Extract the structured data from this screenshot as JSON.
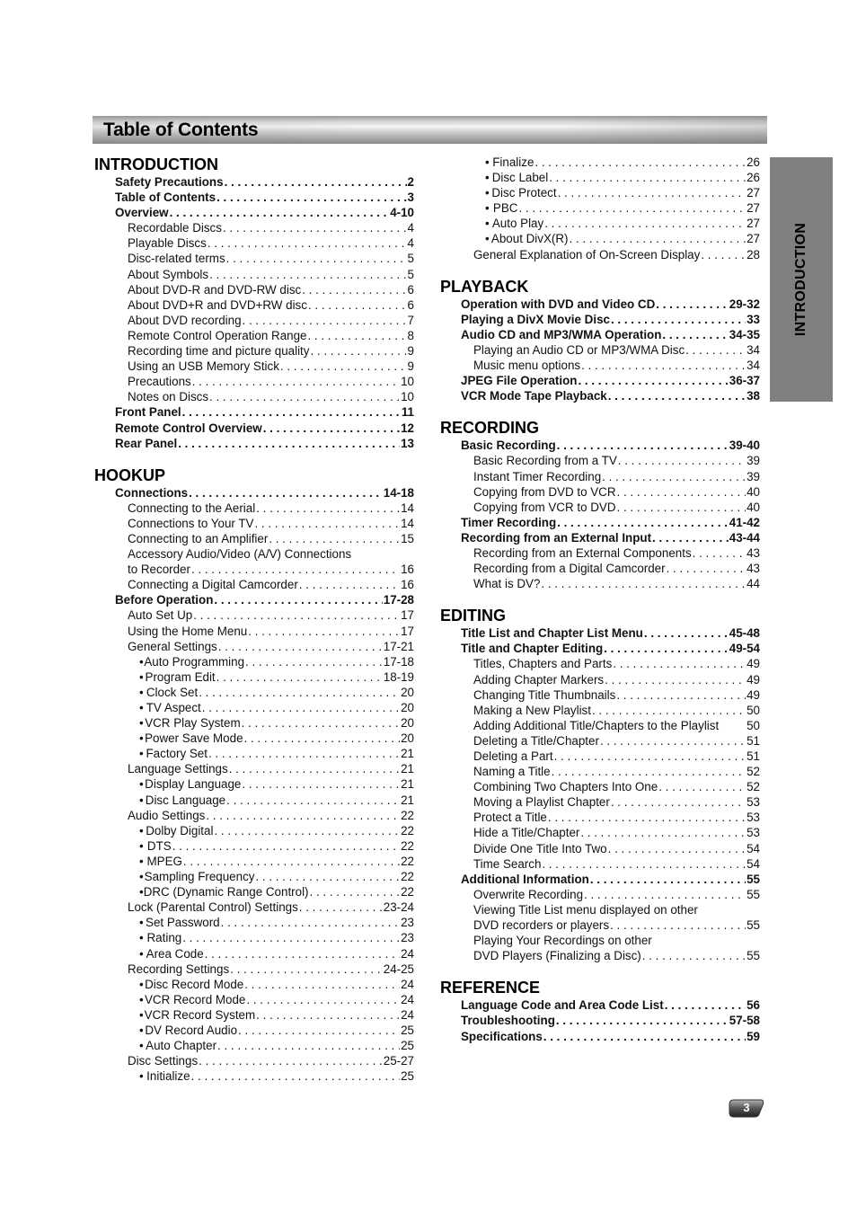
{
  "header": {
    "title": "Table of Contents"
  },
  "side_tab": {
    "label": "INTRODUCTION"
  },
  "page_number": "3",
  "left_column": [
    {
      "heading": "INTRODUCTION",
      "entries": [
        {
          "level": 1,
          "label": "Safety Precautions",
          "page": "2"
        },
        {
          "level": 1,
          "label": "Table of Contents",
          "page": "3"
        },
        {
          "level": 1,
          "label": "Overview",
          "page": "4-10"
        },
        {
          "level": 2,
          "label": "Recordable Discs",
          "page": "4"
        },
        {
          "level": 2,
          "label": "Playable Discs",
          "page": "4"
        },
        {
          "level": 2,
          "label": "Disc-related terms",
          "page": "5"
        },
        {
          "level": 2,
          "label": "About Symbols",
          "page": "5"
        },
        {
          "level": 2,
          "label": "About DVD-R and DVD-RW disc",
          "page": "6"
        },
        {
          "level": 2,
          "label": "About DVD+R and DVD+RW disc",
          "page": "6"
        },
        {
          "level": 2,
          "label": "About DVD recording",
          "page": "7"
        },
        {
          "level": 2,
          "label": "Remote Control Operation Range",
          "page": "8"
        },
        {
          "level": 2,
          "label": "Recording time and picture quality",
          "page": "9"
        },
        {
          "level": 2,
          "label": "Using an USB Memory Stick",
          "page": "9"
        },
        {
          "level": 2,
          "label": "Precautions",
          "page": "10"
        },
        {
          "level": 2,
          "label": "Notes on Discs",
          "page": "10"
        },
        {
          "level": 1,
          "label": "Front Panel",
          "page": "11"
        },
        {
          "level": 1,
          "label": "Remote Control Overview",
          "page": "12"
        },
        {
          "level": 1,
          "label": "Rear Panel",
          "page": "13"
        }
      ]
    },
    {
      "heading": "HOOKUP",
      "entries": [
        {
          "level": 1,
          "label": "Connections",
          "page": "14-18"
        },
        {
          "level": 2,
          "label": "Connecting to the Aerial",
          "page": "14"
        },
        {
          "level": 2,
          "label": "Connections to Your TV",
          "page": "14"
        },
        {
          "level": 2,
          "label": "Connecting to an Amplifier",
          "page": "15"
        },
        {
          "level": 2,
          "label": "Accessory Audio/Video (A/V) Connections",
          "page": ""
        },
        {
          "level": 2,
          "label": "to Recorder",
          "page": "16"
        },
        {
          "level": 2,
          "label": "Connecting a Digital Camcorder",
          "page": "16"
        },
        {
          "level": 1,
          "label": "Before Operation",
          "page": "17-28"
        },
        {
          "level": 2,
          "label": "Auto Set Up",
          "page": "17"
        },
        {
          "level": 2,
          "label": "Using the Home Menu",
          "page": "17"
        },
        {
          "level": 2,
          "label": "General Settings",
          "page": "17-21"
        },
        {
          "level": 3,
          "label": "Auto Programming",
          "page": "17-18"
        },
        {
          "level": 3,
          "label": "Program Edit",
          "page": "18-19"
        },
        {
          "level": 3,
          "label": "Clock Set",
          "page": "20"
        },
        {
          "level": 3,
          "label": "TV Aspect",
          "page": "20"
        },
        {
          "level": 3,
          "label": "VCR Play System",
          "page": "20"
        },
        {
          "level": 3,
          "label": "Power Save Mode",
          "page": "20"
        },
        {
          "level": 3,
          "label": "Factory Set",
          "page": "21"
        },
        {
          "level": 2,
          "label": "Language Settings",
          "page": "21"
        },
        {
          "level": 3,
          "label": "Display Language",
          "page": "21"
        },
        {
          "level": 3,
          "label": "Disc Language",
          "page": "21"
        },
        {
          "level": 2,
          "label": "Audio Settings",
          "page": "22"
        },
        {
          "level": 3,
          "label": "Dolby Digital",
          "page": "22"
        },
        {
          "level": 3,
          "label": "DTS",
          "page": "22"
        },
        {
          "level": 3,
          "label": "MPEG",
          "page": "22"
        },
        {
          "level": 3,
          "label": "Sampling Frequency",
          "page": "22"
        },
        {
          "level": 3,
          "label": "DRC (Dynamic Range Control)",
          "page": "22"
        },
        {
          "level": 2,
          "label": "Lock (Parental Control) Settings",
          "page": "23-24"
        },
        {
          "level": 3,
          "label": "Set Password",
          "page": "23"
        },
        {
          "level": 3,
          "label": "Rating",
          "page": "23"
        },
        {
          "level": 3,
          "label": "Area Code",
          "page": "24"
        },
        {
          "level": 2,
          "label": "Recording Settings",
          "page": "24-25"
        },
        {
          "level": 3,
          "label": "Disc Record Mode",
          "page": "24"
        },
        {
          "level": 3,
          "label": "VCR Record Mode",
          "page": "24"
        },
        {
          "level": 3,
          "label": "VCR Record System",
          "page": "24"
        },
        {
          "level": 3,
          "label": "DV Record Audio",
          "page": "25"
        },
        {
          "level": 3,
          "label": "Auto Chapter",
          "page": "25"
        },
        {
          "level": 2,
          "label": "Disc Settings",
          "page": "25-27"
        },
        {
          "level": 3,
          "label": "Initialize",
          "page": "25"
        }
      ]
    }
  ],
  "right_column": [
    {
      "heading": "",
      "entries": [
        {
          "level": 3,
          "label": "Finalize",
          "page": "26"
        },
        {
          "level": 3,
          "label": "Disc Label",
          "page": "26"
        },
        {
          "level": 3,
          "label": "Disc Protect",
          "page": "27"
        },
        {
          "level": 3,
          "label": "PBC",
          "page": "27"
        },
        {
          "level": 3,
          "label": "Auto Play",
          "page": "27"
        },
        {
          "level": 3,
          "label": "About DivX(R)",
          "page": "27"
        },
        {
          "level": 2,
          "label": "General Explanation of On-Screen Display",
          "page": "28"
        }
      ]
    },
    {
      "heading": "PLAYBACK",
      "entries": [
        {
          "level": 1,
          "label": "Operation with DVD and Video CD",
          "page": "29-32"
        },
        {
          "level": 1,
          "label": "Playing a DivX Movie Disc",
          "page": "33"
        },
        {
          "level": 1,
          "label": "Audio CD and MP3/WMA Operation",
          "page": "34-35"
        },
        {
          "level": 2,
          "label": "Playing an Audio CD or MP3/WMA Disc",
          "page": "34"
        },
        {
          "level": 2,
          "label": "Music menu options",
          "page": "34"
        },
        {
          "level": 1,
          "label": "JPEG File Operation",
          "page": "36-37"
        },
        {
          "level": 1,
          "label": "VCR Mode Tape Playback",
          "page": "38"
        }
      ]
    },
    {
      "heading": "RECORDING",
      "entries": [
        {
          "level": 1,
          "label": "Basic Recording",
          "page": "39-40"
        },
        {
          "level": 2,
          "label": "Basic Recording from a TV",
          "page": "39"
        },
        {
          "level": 2,
          "label": "Instant Timer Recording",
          "page": "39"
        },
        {
          "level": 2,
          "label": "Copying from DVD to VCR",
          "page": "40"
        },
        {
          "level": 2,
          "label": "Copying from VCR to DVD",
          "page": "40"
        },
        {
          "level": 1,
          "label": "Timer Recording",
          "page": "41-42"
        },
        {
          "level": 1,
          "label": "Recording from an External Input",
          "page": "43-44"
        },
        {
          "level": 2,
          "label": "Recording from an External Components",
          "page": "43"
        },
        {
          "level": 2,
          "label": "Recording from a Digital Camcorder",
          "page": "43"
        },
        {
          "level": 2,
          "label": "What is DV?",
          "page": "44"
        }
      ]
    },
    {
      "heading": "EDITING",
      "entries": [
        {
          "level": 1,
          "label": "Title List and Chapter List Menu",
          "page": "45-48"
        },
        {
          "level": 1,
          "label": "Title and Chapter Editing",
          "page": "49-54"
        },
        {
          "level": 2,
          "label": "Titles, Chapters and Parts",
          "page": "49"
        },
        {
          "level": 2,
          "label": "Adding Chapter Markers",
          "page": "49"
        },
        {
          "level": 2,
          "label": "Changing Title Thumbnails",
          "page": "49"
        },
        {
          "level": 2,
          "label": "Making a New Playlist",
          "page": "50"
        },
        {
          "level": 2,
          "label": "Adding Additional Title/Chapters to the Playlist",
          "page": "50",
          "noleader": true
        },
        {
          "level": 2,
          "label": "Deleting a Title/Chapter",
          "page": "51"
        },
        {
          "level": 2,
          "label": "Deleting a Part",
          "page": "51"
        },
        {
          "level": 2,
          "label": "Naming a Title",
          "page": "52"
        },
        {
          "level": 2,
          "label": "Combining Two Chapters Into One",
          "page": "52"
        },
        {
          "level": 2,
          "label": "Moving a Playlist Chapter",
          "page": "53"
        },
        {
          "level": 2,
          "label": "Protect a Title",
          "page": "53"
        },
        {
          "level": 2,
          "label": "Hide a Title/Chapter",
          "page": "53"
        },
        {
          "level": 2,
          "label": "Divide One Title Into Two",
          "page": "54"
        },
        {
          "level": 2,
          "label": "Time Search",
          "page": "54"
        },
        {
          "level": 1,
          "label": "Additional Information",
          "page": "55"
        },
        {
          "level": 2,
          "label": "Overwrite Recording",
          "page": "55"
        },
        {
          "level": 2,
          "label": "Viewing Title List menu displayed on other",
          "page": ""
        },
        {
          "level": 2,
          "label": "DVD recorders or players",
          "page": "55"
        },
        {
          "level": 2,
          "label": "Playing Your Recordings on other",
          "page": ""
        },
        {
          "level": 2,
          "label": "DVD Players (Finalizing a Disc)",
          "page": "55"
        }
      ]
    },
    {
      "heading": "REFERENCE",
      "entries": [
        {
          "level": 1,
          "label": "Language Code and Area Code List",
          "page": "56"
        },
        {
          "level": 1,
          "label": "Troubleshooting",
          "page": "57-58"
        },
        {
          "level": 1,
          "label": "Specifications",
          "page": "59"
        }
      ]
    }
  ]
}
